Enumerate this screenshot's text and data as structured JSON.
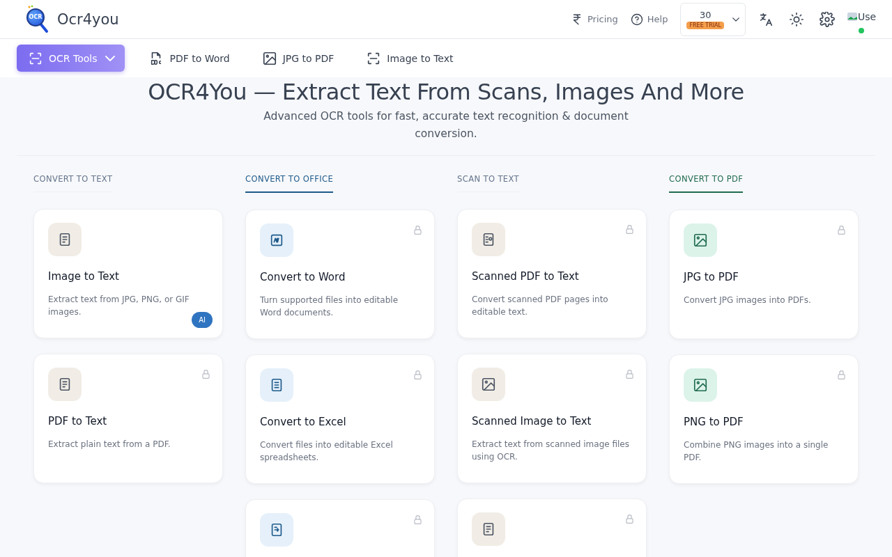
{
  "header": {
    "logo_mark": "OCR",
    "brand": "Ocr4you",
    "links": [
      {
        "kind": "pricing",
        "label": "Pricing"
      },
      {
        "kind": "help",
        "label": "Help"
      }
    ],
    "credits": {
      "count": "30",
      "badge": "FREE TRIAL"
    },
    "avatar_alt": "Use",
    "online": true
  },
  "nav": [
    {
      "kind": "scan",
      "label": "OCR Tools",
      "selected": true,
      "dropdown": true
    },
    {
      "kind": "doc",
      "label": "PDF to Word",
      "selected": false,
      "dropdown": false
    },
    {
      "kind": "image",
      "label": "JPG to PDF",
      "selected": false,
      "dropdown": false
    },
    {
      "kind": "scan",
      "label": "Image to Text",
      "selected": false,
      "dropdown": false
    }
  ],
  "hero": {
    "title": "OCR4You — Extract Text From Scans, Images And More",
    "subtitle": "Advanced OCR tools for fast, accurate text recognition & document conversion."
  },
  "columns": [
    {
      "heading": "CONVERT TO TEXT",
      "color": "#64748b",
      "underlined": false,
      "cards": [
        {
          "kind": "text",
          "title": "Image to Text",
          "description": "Extract text from JPG, PNG, or GIF images.",
          "locked": false,
          "badge": "AI"
        },
        {
          "kind": "text",
          "title": "PDF to Text",
          "description": "Extract plain text from a PDF.",
          "locked": true
        }
      ]
    },
    {
      "heading": "CONVERT TO OFFICE",
      "color": "#1e5a8a",
      "underlined": true,
      "cards": [
        {
          "kind": "word",
          "title": "Convert to Word",
          "description": "Turn supported files into editable Word documents.",
          "locked": true
        },
        {
          "kind": "excel",
          "title": "Convert to Excel",
          "description": "Convert files into editable Excel spreadsheets.",
          "locked": true
        },
        {
          "kind": "convert",
          "locked": true
        }
      ]
    },
    {
      "heading": "SCAN TO TEXT",
      "color": "#64748b",
      "underlined": false,
      "cards": [
        {
          "kind": "scan",
          "title": "Scanned PDF to Text",
          "description": "Convert scanned PDF pages into editable text.",
          "locked": true
        },
        {
          "kind": "photo",
          "title": "Scanned Image to Text",
          "description": "Extract text from scanned image files using OCR.",
          "locked": true
        },
        {
          "kind": "text",
          "locked": true
        }
      ]
    },
    {
      "heading": "CONVERT TO PDF",
      "color": "#1f6b4f",
      "underlined": true,
      "cards": [
        {
          "kind": "pdf",
          "title": "JPG to PDF",
          "description": "Convert JPG images into PDFs.",
          "locked": true
        },
        {
          "kind": "pdf",
          "title": "PNG to PDF",
          "description": "Combine PNG images into a single PDF.",
          "locked": true
        }
      ]
    }
  ]
}
